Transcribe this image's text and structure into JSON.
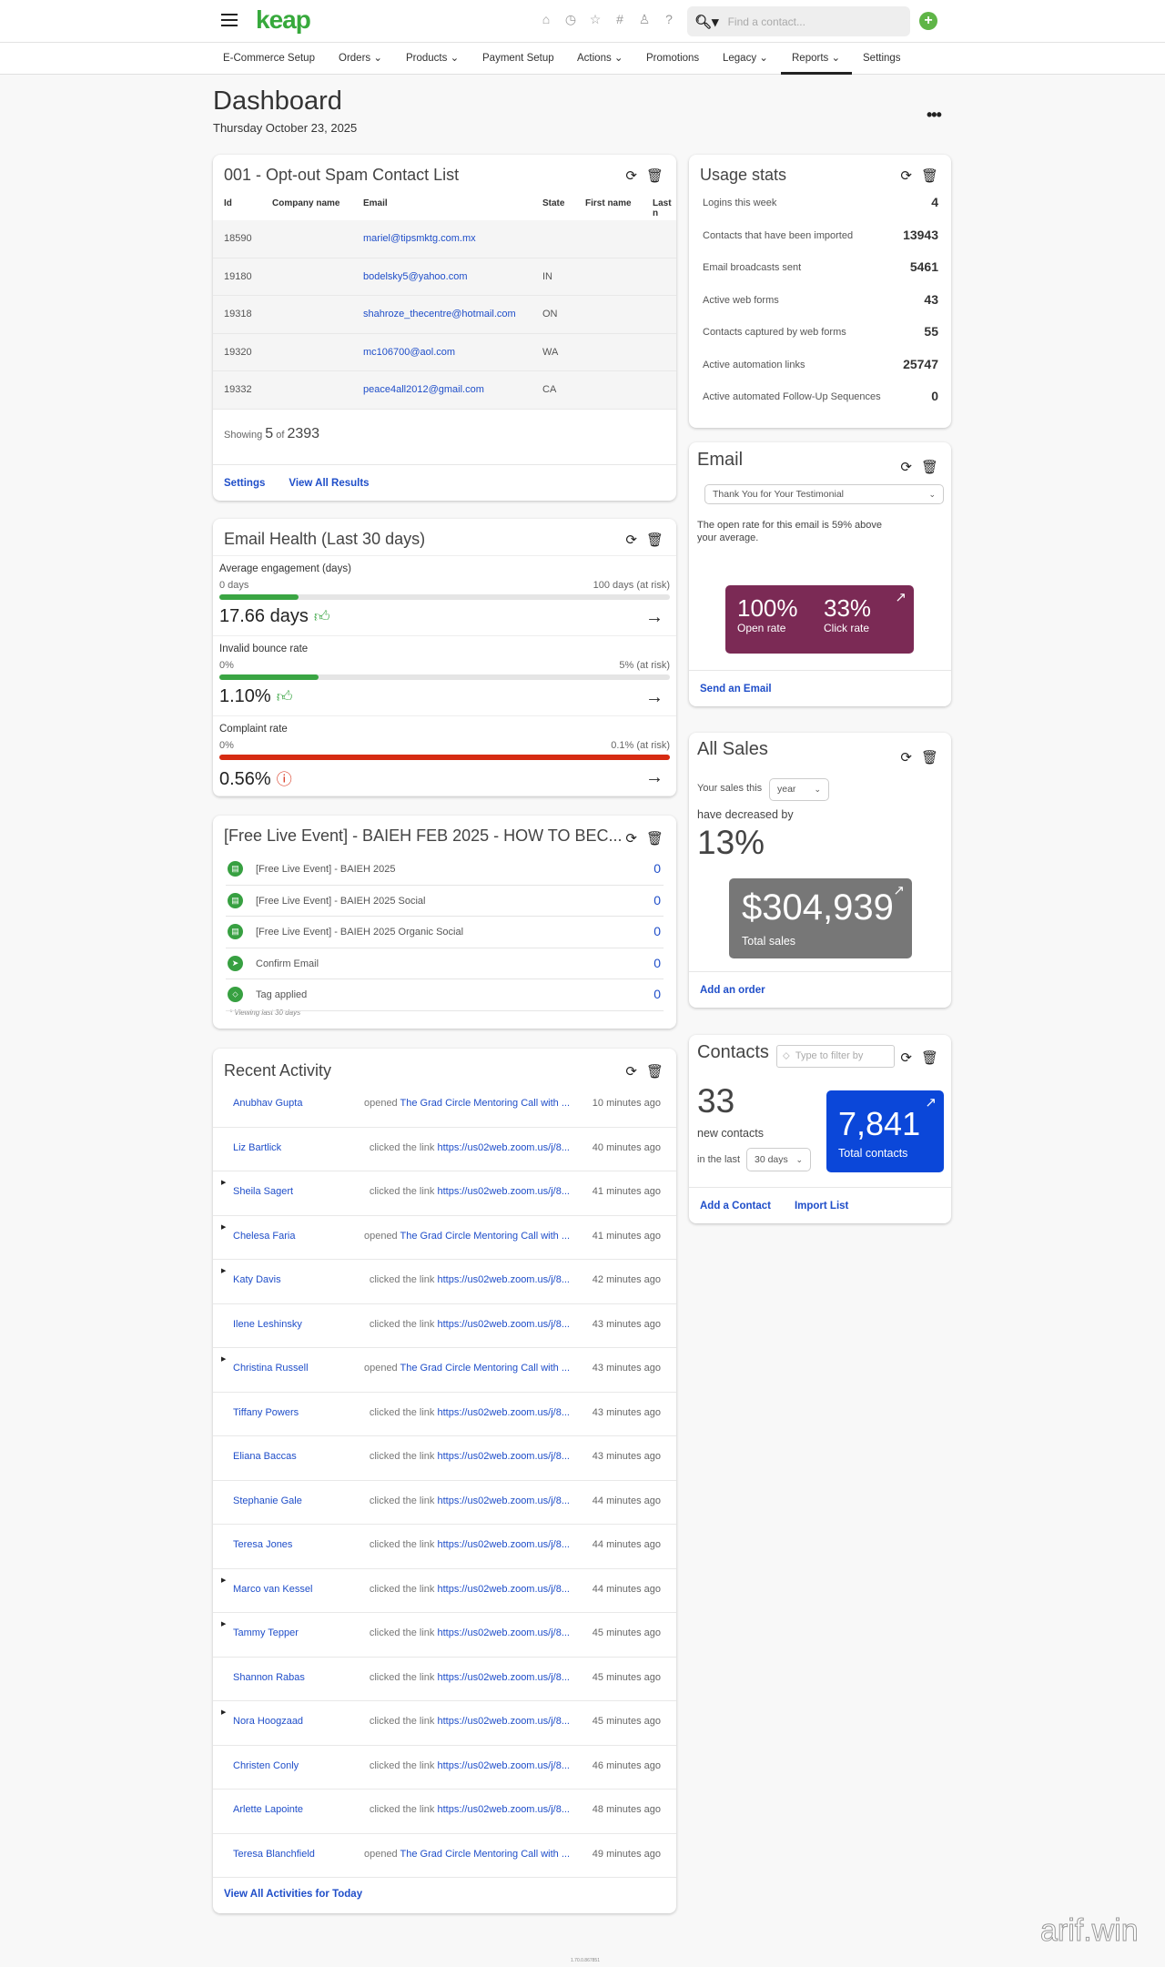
{
  "header": {
    "logo": "keap",
    "search_placeholder": "Find a contact...",
    "icons": [
      "home-icon",
      "clock-icon",
      "star-icon",
      "hashtag-icon",
      "person-icon",
      "help-icon"
    ],
    "brand_color": "#37a93c"
  },
  "nav": {
    "items": [
      {
        "label": "E-Commerce Setup"
      },
      {
        "label": "Orders ⌄"
      },
      {
        "label": "Products ⌄"
      },
      {
        "label": "Payment Setup"
      },
      {
        "label": "Actions ⌄"
      },
      {
        "label": "Promotions"
      },
      {
        "label": "Legacy ⌄"
      },
      {
        "label": "Reports ⌄"
      },
      {
        "label": "Settings"
      }
    ],
    "active": "Reports"
  },
  "page": {
    "title": "Dashboard",
    "date": "Thursday October 23, 2025",
    "more": "•••"
  },
  "spam": {
    "title": "001 - Opt-out Spam Contact List",
    "columns": [
      "Id",
      "Company name",
      "Email",
      "State",
      "First name",
      "Last n"
    ],
    "rows": [
      {
        "id": "18590",
        "company": "",
        "email": "mariel@tipsmktg.com.mx",
        "state": ""
      },
      {
        "id": "19180",
        "company": "",
        "email": "bodelsky5@yahoo.com",
        "state": "IN"
      },
      {
        "id": "19318",
        "company": "",
        "email": "shahroze_thecentre@hotmail.com",
        "state": "ON"
      },
      {
        "id": "19320",
        "company": "",
        "email": "mc106700@aol.com",
        "state": "WA"
      },
      {
        "id": "19332",
        "company": "",
        "email": "peace4all2012@gmail.com",
        "state": "CA"
      }
    ],
    "showing_label": "Showing",
    "showing_count": "5",
    "of_label": "of",
    "total": "2393",
    "settings": "Settings",
    "view_all": "View All Results"
  },
  "health": {
    "title": "Email Health (Last 30 days)",
    "metrics": [
      {
        "label": "Average engagement (days)",
        "min": "0 days",
        "max": "100 days (at risk)",
        "value": "17.66 days",
        "fill_percent": 17.66,
        "status": "good",
        "color": "#3aa543"
      },
      {
        "label": "Invalid bounce rate",
        "min": "0%",
        "max": "5% (at risk)",
        "value": "1.10%",
        "fill_percent": 22,
        "status": "good",
        "color": "#3aa543"
      },
      {
        "label": "Complaint rate",
        "min": "0%",
        "max": "0.1% (at risk)",
        "value": "0.56%",
        "fill_percent": 100,
        "status": "warning",
        "color": "#d62b12"
      }
    ]
  },
  "campaign": {
    "title": "[Free Live Event] - BAIEH FEB 2025 - HOW TO BEC...",
    "items": [
      {
        "icon": "form-icon",
        "label": "[Free Live Event] - BAIEH 2025",
        "count": "0"
      },
      {
        "icon": "form-icon",
        "label": "[Free Live Event] - BAIEH 2025 Social",
        "count": "0"
      },
      {
        "icon": "form-icon",
        "label": "[Free Live Event] - BAIEH 2025 Organic Social",
        "count": "0"
      },
      {
        "icon": "cursor-icon",
        "label": "Confirm Email",
        "count": "0"
      },
      {
        "icon": "tag-icon",
        "label": "Tag applied",
        "count": "0"
      }
    ],
    "note": "* Viewing last 30 days"
  },
  "activity": {
    "title": "Recent Activity",
    "view_all": "View All Activities for Today",
    "rows": [
      {
        "name": "Anubhav Gupta",
        "verb": "opened",
        "target": "The Grad Circle Mentoring Call with ...",
        "time": "10 minutes ago",
        "expandable": false
      },
      {
        "name": "Liz Bartlick",
        "verb": "clicked the link",
        "target": "https://us02web.zoom.us/j/8...",
        "time": "40 minutes ago",
        "expandable": false
      },
      {
        "name": "Sheila Sagert",
        "verb": "clicked the link",
        "target": "https://us02web.zoom.us/j/8...",
        "time": "41 minutes ago",
        "expandable": true
      },
      {
        "name": "Chelesa Faria",
        "verb": "opened",
        "target": "The Grad Circle Mentoring Call with ...",
        "time": "41 minutes ago",
        "expandable": true
      },
      {
        "name": "Katy Davis",
        "verb": "clicked the link",
        "target": "https://us02web.zoom.us/j/8...",
        "time": "42 minutes ago",
        "expandable": true
      },
      {
        "name": "Ilene Leshinsky",
        "verb": "clicked the link",
        "target": "https://us02web.zoom.us/j/8...",
        "time": "43 minutes ago",
        "expandable": false
      },
      {
        "name": "Christina Russell",
        "verb": "opened",
        "target": "The Grad Circle Mentoring Call with ...",
        "time": "43 minutes ago",
        "expandable": true
      },
      {
        "name": "Tiffany Powers",
        "verb": "clicked the link",
        "target": "https://us02web.zoom.us/j/8...",
        "time": "43 minutes ago",
        "expandable": false
      },
      {
        "name": "Eliana Baccas",
        "verb": "clicked the link",
        "target": "https://us02web.zoom.us/j/8...",
        "time": "43 minutes ago",
        "expandable": false
      },
      {
        "name": "Stephanie Gale",
        "verb": "clicked the link",
        "target": "https://us02web.zoom.us/j/8...",
        "time": "44 minutes ago",
        "expandable": false
      },
      {
        "name": "Teresa Jones",
        "verb": "clicked the link",
        "target": "https://us02web.zoom.us/j/8...",
        "time": "44 minutes ago",
        "expandable": false
      },
      {
        "name": "Marco van Kessel",
        "verb": "clicked the link",
        "target": "https://us02web.zoom.us/j/8...",
        "time": "44 minutes ago",
        "expandable": true
      },
      {
        "name": "Tammy Tepper",
        "verb": "clicked the link",
        "target": "https://us02web.zoom.us/j/8...",
        "time": "45 minutes ago",
        "expandable": true
      },
      {
        "name": "Shannon Rabas",
        "verb": "clicked the link",
        "target": "https://us02web.zoom.us/j/8...",
        "time": "45 minutes ago",
        "expandable": false
      },
      {
        "name": "Nora Hoogzaad",
        "verb": "clicked the link",
        "target": "https://us02web.zoom.us/j/8...",
        "time": "45 minutes ago",
        "expandable": true
      },
      {
        "name": "Christen Conly",
        "verb": "clicked the link",
        "target": "https://us02web.zoom.us/j/8...",
        "time": "46 minutes ago",
        "expandable": false
      },
      {
        "name": "Arlette Lapointe",
        "verb": "clicked the link",
        "target": "https://us02web.zoom.us/j/8...",
        "time": "48 minutes ago",
        "expandable": false
      },
      {
        "name": "Teresa Blanchfield",
        "verb": "opened",
        "target": "The Grad Circle Mentoring Call with ...",
        "time": "49 minutes ago",
        "expandable": false
      }
    ]
  },
  "usage": {
    "title": "Usage stats",
    "rows": [
      {
        "label": "Logins this week",
        "value": "4"
      },
      {
        "label": "Contacts that have been imported",
        "value": "13943"
      },
      {
        "label": "Email broadcasts sent",
        "value": "5461"
      },
      {
        "label": "Active web forms",
        "value": "43"
      },
      {
        "label": "Contacts captured by web forms",
        "value": "55"
      },
      {
        "label": "Active automation links",
        "value": "25747"
      },
      {
        "label": "Active automated Follow-Up Sequences",
        "value": "0"
      }
    ]
  },
  "email": {
    "title": "Email",
    "selected": "Thank You for Your Testimonial",
    "message": "The open rate for this email is 59% above your average.",
    "open_rate": "100%",
    "open_label": "Open rate",
    "click_rate": "33%",
    "click_label": "Click rate",
    "tile_color": "#7b2a55",
    "send": "Send an Email"
  },
  "sales": {
    "title": "All Sales",
    "prefix": "Your sales this",
    "period": "year",
    "change_label": "have decreased by",
    "change": "13%",
    "total": "$304,939",
    "total_label": "Total sales",
    "add_order": "Add an order"
  },
  "contacts": {
    "title": "Contacts",
    "filter_placeholder": "Type to filter by",
    "new_count": "33",
    "new_label": "new contacts",
    "range_prefix": "in the last",
    "range": "30 days",
    "total": "7,841",
    "total_label": "Total contacts",
    "tile_color": "#0b47d9",
    "add": "Add a Contact",
    "import": "Import List"
  },
  "footer": {
    "version": "1.70.0.867851",
    "watermark": "arif.win"
  }
}
